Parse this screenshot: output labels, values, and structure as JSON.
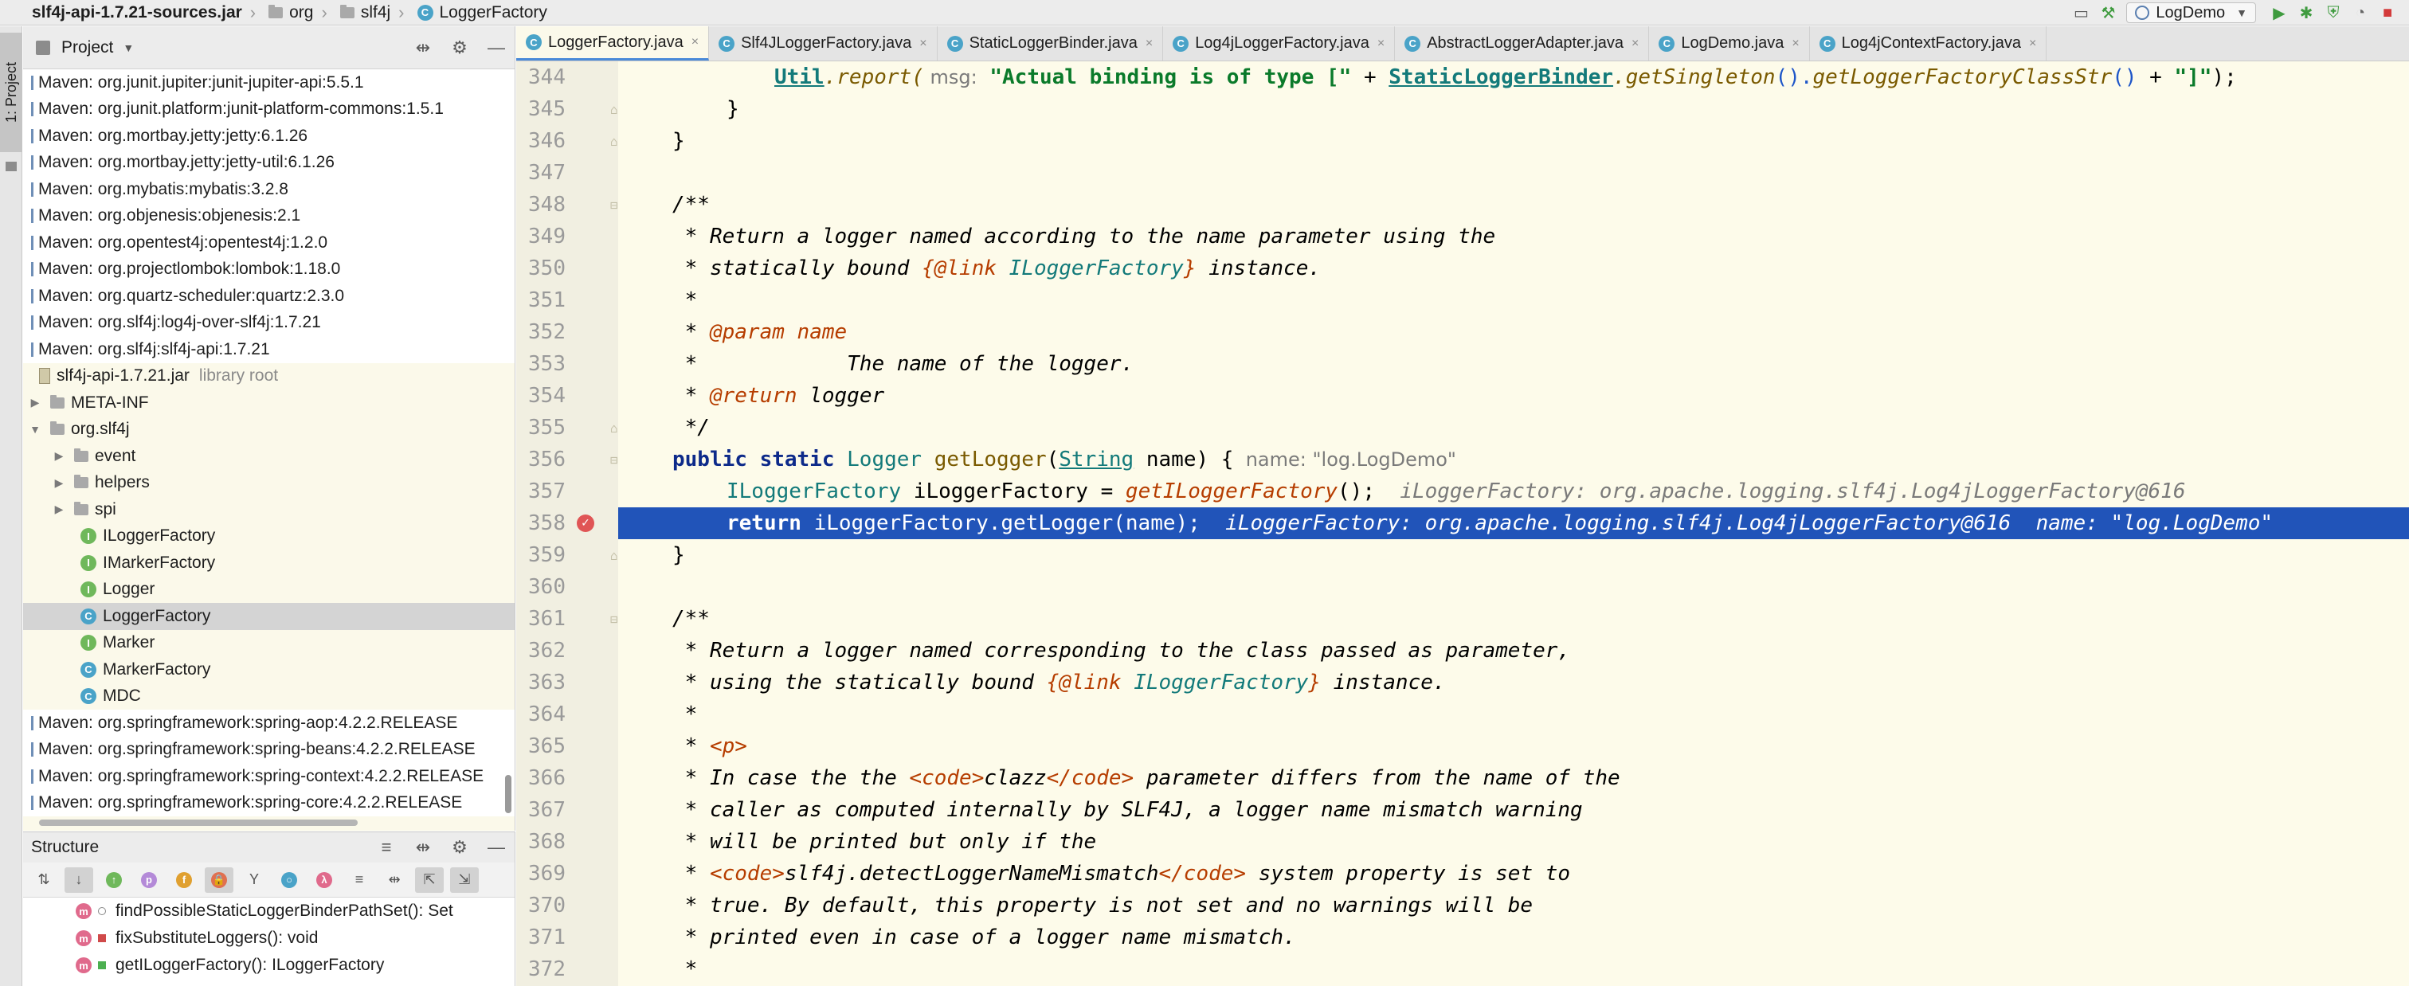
{
  "breadcrumb": {
    "jar": "slf4j-api-1.7.21-sources.jar",
    "pkg1": "org",
    "pkg2": "slf4j",
    "cls": "LoggerFactory"
  },
  "run_config": {
    "label": "LogDemo"
  },
  "icons": {
    "layout": "layout-icon",
    "build": "hammer-icon",
    "run": "run-icon",
    "debug": "debug-icon",
    "coverage": "coverage-icon",
    "profile": "profile-icon",
    "stop": "stop-icon"
  },
  "colors": {
    "exec_line": "#2154b9",
    "keyword": "#0d2a8a",
    "string": "#0a7a2a",
    "comment": "#8c8c8c",
    "tree_bg": "#fbf9ea"
  },
  "tool_stripe": {
    "project_tab": "1: Project"
  },
  "project_panel": {
    "title": "Project",
    "libraries": [
      "Maven: org.junit.jupiter:junit-jupiter-api:5.5.1",
      "Maven: org.junit.platform:junit-platform-commons:1.5.1",
      "Maven: org.mortbay.jetty:jetty:6.1.26",
      "Maven: org.mortbay.jetty:jetty-util:6.1.26",
      "Maven: org.mybatis:mybatis:3.2.8",
      "Maven: org.objenesis:objenesis:2.1",
      "Maven: org.opentest4j:opentest4j:1.2.0",
      "Maven: org.projectlombok:lombok:1.18.0",
      "Maven: org.quartz-scheduler:quartz:2.3.0",
      "Maven: org.slf4j:log4j-over-slf4j:1.7.21",
      "Maven: org.slf4j:slf4j-api:1.7.21"
    ],
    "jar_root": {
      "name": "slf4j-api-1.7.21.jar",
      "note": "library root"
    },
    "meta_inf": "META-INF",
    "org_slf4j": "org.slf4j",
    "packages": [
      "event",
      "helpers",
      "spi"
    ],
    "classes": [
      {
        "name": "ILoggerFactory",
        "kind": "I"
      },
      {
        "name": "IMarkerFactory",
        "kind": "I"
      },
      {
        "name": "Logger",
        "kind": "I"
      },
      {
        "name": "LoggerFactory",
        "kind": "C"
      },
      {
        "name": "Marker",
        "kind": "I"
      },
      {
        "name": "MarkerFactory",
        "kind": "C"
      },
      {
        "name": "MDC",
        "kind": "C"
      }
    ],
    "libraries_after": [
      "Maven: org.springframework:spring-aop:4.2.2.RELEASE",
      "Maven: org.springframework:spring-beans:4.2.2.RELEASE",
      "Maven: org.springframework:spring-context:4.2.2.RELEASE",
      "Maven: org.springframework:spring-core:4.2.2.RELEASE"
    ]
  },
  "structure_panel": {
    "title": "Structure",
    "members": [
      "findPossibleStaticLoggerBinderPathSet(): Set",
      "fixSubstituteLoggers(): void",
      "getILoggerFactory(): ILoggerFactory"
    ]
  },
  "tabs": [
    "LoggerFactory.java",
    "Slf4JLoggerFactory.java",
    "StaticLoggerBinder.java",
    "Log4jLoggerFactory.java",
    "AbstractLoggerAdapter.java",
    "LogDemo.java",
    "Log4jContextFactory.java"
  ],
  "code": {
    "line_numbers": [
      "344",
      "345",
      "346",
      "347",
      "348",
      "349",
      "350",
      "351",
      "352",
      "353",
      "354",
      "355",
      "356",
      "357",
      "358",
      "359",
      "360",
      "361",
      "362",
      "363",
      "364",
      "365",
      "366",
      "367",
      "368",
      "369",
      "370",
      "371",
      "372"
    ],
    "l344": {
      "cls": "Util",
      "method": ".report(",
      "hint": " msg:",
      "str": "\"Actual binding is of type [\"",
      "plus": " + ",
      "cls2": "StaticLoggerBinder",
      "m2": ".getSingleton",
      "p2": "().",
      "m3": "getLoggerFactoryClassStr",
      "p3": "()",
      "plus2": " + ",
      "str2": "\"]\"",
      "end": ");"
    },
    "l345": "}",
    "l346": "}",
    "l348": "/**",
    "l349": " * Return a logger named according to the name parameter using the",
    "l350a": " * statically bound ",
    "l350b": "{@link ",
    "l350c": "ILoggerFactory",
    "l350d": "}",
    "l350e": " instance.",
    "l351": " *",
    "l352a": " * ",
    "l352b": "@param",
    "l352c": " name",
    "l353": " *            The name of the logger.",
    "l354a": " * ",
    "l354b": "@return",
    "l354c": " logger",
    "l355": " */",
    "l356": {
      "k1": "public static ",
      "t1": "Logger ",
      "m": "getLogger",
      "p1": "(",
      "t2": "String",
      "p2": " name) {",
      "hint": "  name: ",
      "hint_val": "\"log.LogDemo\""
    },
    "l357": {
      "t1": "ILoggerFactory",
      "p1": " iLoggerFactory = ",
      "m": "getILoggerFactory",
      "p2": "();",
      "hint": "  iLoggerFactory: org.apache.logging.slf4j.Log4jLoggerFactory@616"
    },
    "l358": {
      "k": "return",
      "p": " iLoggerFactory.getLogger(name);",
      "hint": "  iLoggerFactory: org.apache.logging.slf4j.Log4jLoggerFactory@616  name: \"log.LogDemo\""
    },
    "l359": "}",
    "l361": "/**",
    "l362": " * Return a logger named corresponding to the class passed as parameter,",
    "l363a": " * using the statically bound ",
    "l363b": "{@link ",
    "l363c": "ILoggerFactory",
    "l363d": "}",
    "l363e": " instance.",
    "l364": " *",
    "l365a": " * ",
    "l365b": "<p>",
    "l366a": " * In case the the ",
    "l366b": "<code>",
    "l366c": "clazz",
    "l366d": "</code>",
    "l366e": " parameter differs from the name of the",
    "l367": " * caller as computed internally by SLF4J, a logger name mismatch warning",
    "l368": " * will be printed but only if the",
    "l369a": " * ",
    "l369b": "<code>",
    "l369c": "slf4j.detectLoggerNameMismatch",
    "l369d": "</code>",
    "l369e": " system property is set to",
    "l370": " * true. By default, this property is not set and no warnings will be",
    "l371": " * printed even in case of a logger name mismatch.",
    "l372": " *"
  }
}
